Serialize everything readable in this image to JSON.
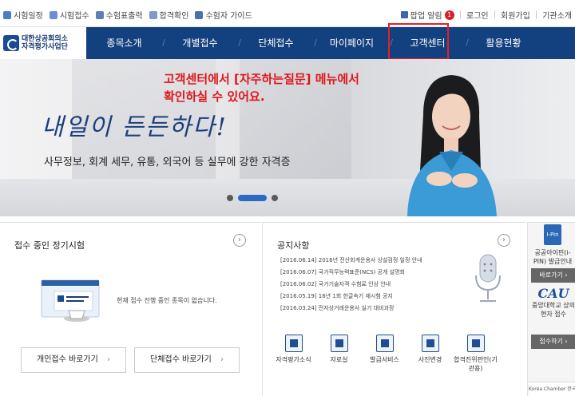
{
  "topbar": {
    "left_links": [
      {
        "label": "시험일정",
        "icon": "calendar-icon",
        "color": "#4a7ec9"
      },
      {
        "label": "시험접수",
        "icon": "edit-icon",
        "color": "#6b8fd1"
      },
      {
        "label": "수험표출력",
        "icon": "print-icon",
        "color": "#5d7fb8"
      },
      {
        "label": "합격확인",
        "icon": "check-icon",
        "color": "#7d9ac9"
      },
      {
        "label": "수험자 가이드",
        "icon": "guide-icon",
        "color": "#4f6fa8"
      }
    ],
    "right_links": {
      "alert": "팝업 알림",
      "alert_count": "1",
      "login": "로그인",
      "join": "회원가입",
      "org": "기관소개"
    }
  },
  "nav": {
    "logo_line1": "대한상공회의소",
    "logo_line2": "자격평가사업단",
    "items": [
      "종목소개",
      "개별접수",
      "단체접수",
      "마이페이지",
      "고객센터",
      "활용현황"
    ],
    "bg_color": "#13407f"
  },
  "hero": {
    "annotation_line1": "고객센터에서 [자주하는질문] 메뉴에서",
    "annotation_line2": "확인하실 수 있어요.",
    "slogan": "내일이 든든하다!",
    "subtext": "사무정보, 회계 세무, 유통, 외국어 등 실무에 강한 자격증",
    "slide_count": 3,
    "active_slide": 2
  },
  "exam_panel": {
    "title": "접수 중인 정기시험",
    "more": "›",
    "no_data": "현재 접수 진행 중인 종목이 없습니다.",
    "btn_individual": "개인접수 바로가기",
    "btn_group": "단체접수 바로가기",
    "btn_arrow": "›"
  },
  "notice_panel": {
    "title": "공지사항",
    "more": "›",
    "items": [
      "[2016.06.14] 2016년 전산회계운용사 상설검정 일정 안내",
      "[2016.06.07] 국가직무능력표준(NCS) 공개 설명회",
      "[2016.06.02] 국가기술자격 수험료 인상 안내",
      "[2016.05.19] 16년 1회 한글속기 재시험 공지",
      "[2016.03.24] 전자상거래운용사 실기 대비과정"
    ],
    "services": [
      {
        "label": "자격평가소식",
        "icon": "news-icon"
      },
      {
        "label": "자료실",
        "icon": "archive-icon"
      },
      {
        "label": "발급서비스",
        "icon": "certificate-icon"
      },
      {
        "label": "사진변경",
        "icon": "photo-icon"
      },
      {
        "label": "합격진위판인(기관용)",
        "icon": "verify-icon"
      }
    ]
  },
  "side_panel": {
    "ipin_badge": "I-Pin",
    "ipin_title": "공공아이핀(i-PIN) 발급안내",
    "btn_go": "바로가기 ›",
    "cau_logo": "CAU",
    "cau_text": "중앙대학교 상의 현자 접수",
    "btn_apply": "접수하기 ›",
    "corner": "Korea Chamber 한국표준협회"
  }
}
